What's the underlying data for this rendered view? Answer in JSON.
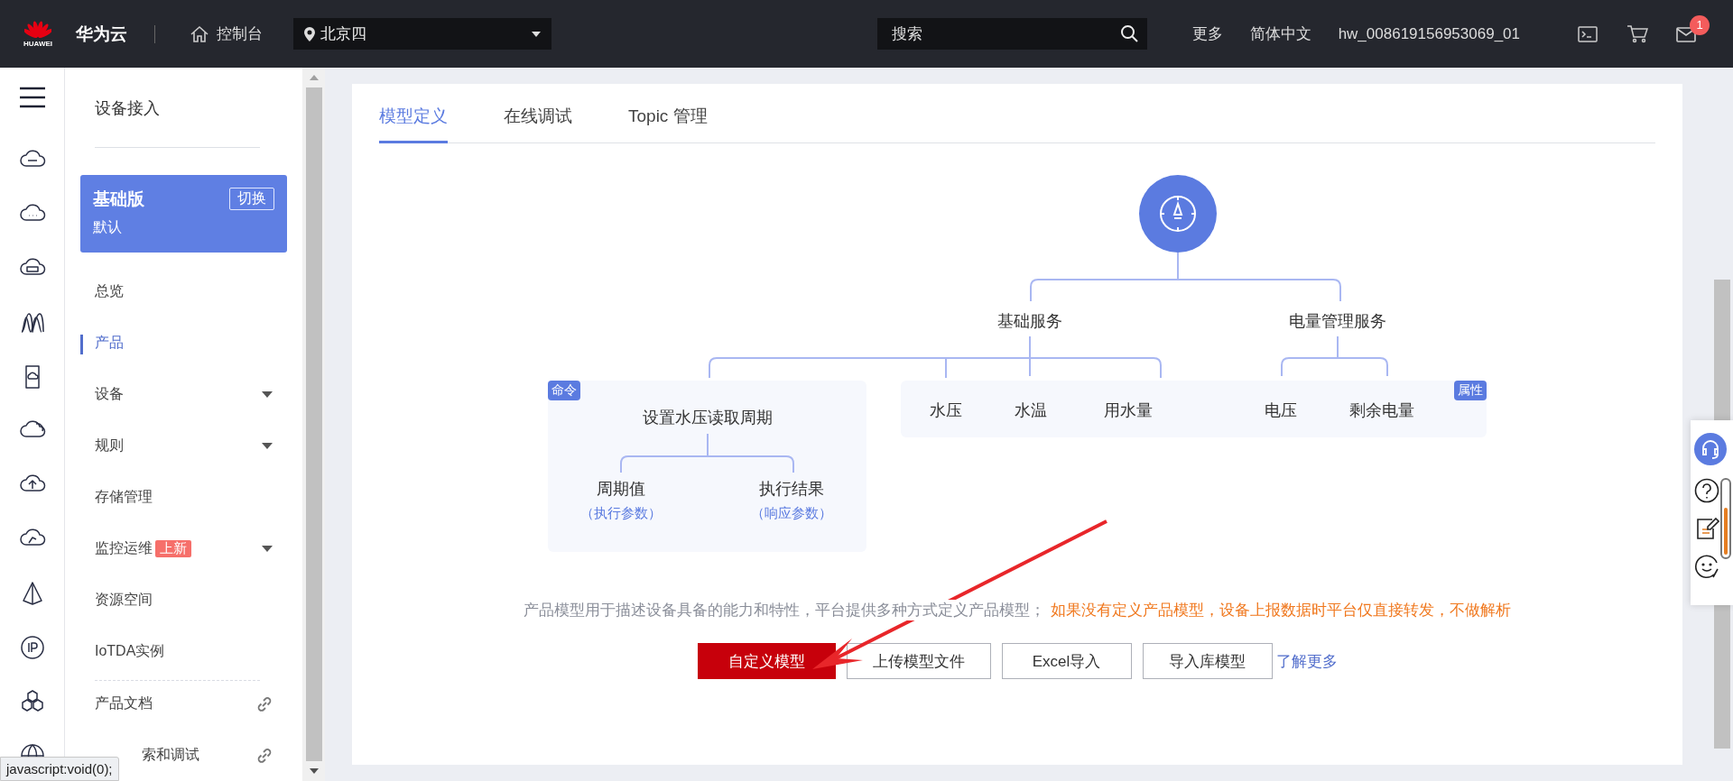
{
  "topbar": {
    "brand": "HUAWEI",
    "product": "华为云",
    "console": "控制台",
    "region": "北京四",
    "search": {
      "placeholder": "搜索"
    },
    "links": [
      "更多",
      "简体中文",
      "hw_008619156953069_01"
    ],
    "mail_badge": "1"
  },
  "sidebar": {
    "title": "设备接入",
    "edition": {
      "name": "基础版",
      "switch": "切换",
      "sub": "默认"
    },
    "items": [
      {
        "label": "总览",
        "kind": "menu",
        "selected": false,
        "expandable": false
      },
      {
        "label": "产品",
        "kind": "menu",
        "selected": true,
        "expandable": false
      },
      {
        "label": "设备",
        "kind": "menu",
        "selected": false,
        "expandable": true
      },
      {
        "label": "规则",
        "kind": "menu",
        "selected": false,
        "expandable": true
      },
      {
        "label": "存储管理",
        "kind": "menu",
        "selected": false,
        "expandable": false
      },
      {
        "label": "监控运维",
        "kind": "menu",
        "selected": false,
        "expandable": true,
        "badge": "上新"
      },
      {
        "label": "资源空间",
        "kind": "menu",
        "selected": false,
        "expandable": false
      },
      {
        "label": "IoTDA实例",
        "kind": "menu",
        "selected": false,
        "expandable": false
      },
      {
        "label": "产品文档",
        "kind": "link",
        "selected": false,
        "expandable": false
      },
      {
        "label": "索和调试",
        "kind": "link",
        "selected": false,
        "expandable": false,
        "covered": true
      }
    ]
  },
  "tabs": [
    {
      "label": "模型定义",
      "selected": true
    },
    {
      "label": "在线调试",
      "selected": false
    },
    {
      "label": "Topic 管理",
      "selected": false
    }
  ],
  "diagram": {
    "services": [
      {
        "name": "基础服务"
      },
      {
        "name": "电量管理服务"
      }
    ],
    "command": {
      "tag": "命令",
      "name": "设置水压读取周期",
      "params": [
        {
          "name": "周期值",
          "role": "（执行参数）"
        },
        {
          "name": "执行结果",
          "role": "（响应参数）"
        }
      ]
    },
    "properties": {
      "tag": "属性",
      "items": [
        "水压",
        "水温",
        "用水量",
        "电压",
        "剩余电量"
      ]
    }
  },
  "description": {
    "text": "产品模型用于描述设备具备的能力和特性，平台提供多种方式定义产品模型；",
    "warning": "如果没有定义产品模型，设备上报数据时平台仅直接转发，不做解析"
  },
  "actions": [
    {
      "label": "自定义模型",
      "kind": "primary"
    },
    {
      "label": "上传模型文件",
      "kind": "default"
    },
    {
      "label": "Excel导入",
      "kind": "default"
    },
    {
      "label": "导入库模型",
      "kind": "default"
    },
    {
      "label": "了解更多",
      "kind": "link"
    }
  ],
  "status_bar": {
    "url": "javascript:void(0);"
  }
}
